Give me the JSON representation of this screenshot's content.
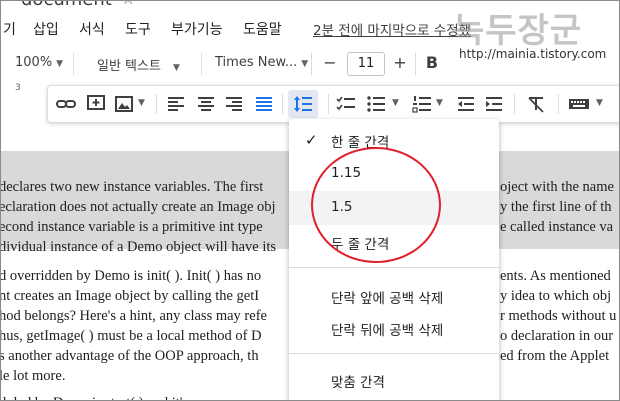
{
  "title": {
    "doc_title": "document",
    "star": "☆"
  },
  "menu": {
    "items": [
      "기",
      "삽입",
      "서식",
      "도구",
      "부가기능",
      "도움말"
    ],
    "last_edit": "2분 전에 마지막으로 수정했"
  },
  "watermark": {
    "brand": "녹두장군",
    "url": "http://mainia.tistory.com"
  },
  "toolbar": {
    "zoom": "100%",
    "style": "일반 텍스트",
    "font": "Times New...",
    "font_size": "11",
    "minus": "−",
    "plus": "+",
    "bold": "B"
  },
  "ruler": {
    "mark": "3"
  },
  "document": {
    "block1": [
      "declares two new instance variables. The first",
      "eclaration does not actually create an Image obj",
      "econd instance variable is a primitive int type",
      "dividual instance of a Demo object will have its"
    ],
    "block1_right": [
      "oject with the name",
      "y the first line of th",
      "e called instance va",
      ""
    ],
    "block2": [
      "d overridden by Demo is init( ). Init( ) has no",
      "nt creates an Image object by calling the getI",
      "hod belongs? Here's a hint, any class may refe",
      "hus, getImage( ) must be a local method of D",
      "s another advantage of the OOP approach, th",
      "le lot more."
    ],
    "block2_right": [
      "ents. As mentioned",
      "y idea to which obj",
      "r methods without u",
      "o declaration in our",
      "ed from the Applet",
      ""
    ],
    "last_line": "d, led by Demo is start( ) and it's"
  },
  "line_spacing_menu": {
    "options": [
      {
        "label": "한 줄 간격",
        "checked": true
      },
      {
        "label": "1.15",
        "checked": false
      },
      {
        "label": "1.5",
        "checked": false
      },
      {
        "label": "두 줄 간격",
        "checked": false
      }
    ],
    "check_mark": "✓",
    "add_before": "단락 앞에 공백 삭제",
    "add_after": "단락 뒤에 공백 삭제",
    "custom": "맞춤 간격"
  },
  "colors": {
    "annotation_circle": "#e0202a",
    "active_button": "#e2e7f3",
    "highlight": "#d9d9d9"
  }
}
